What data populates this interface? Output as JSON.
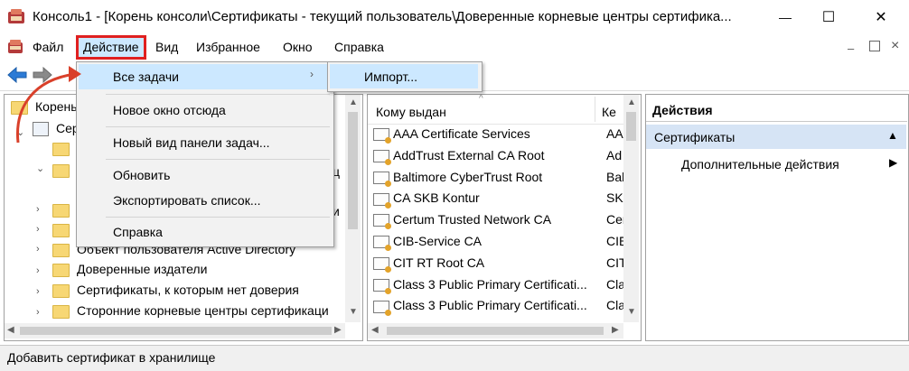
{
  "window": {
    "title": "Консоль1 - [Корень консоли\\Сертификаты - текущий пользователь\\Доверенные корневые центры сертифика...",
    "minimize": "—",
    "maximize": "☐",
    "close": "✕"
  },
  "menu": {
    "file": "Файл",
    "action": "Действие",
    "view": "Вид",
    "favorites": "Избранное",
    "window": "Окно",
    "help": "Справка",
    "inner_min": "–",
    "inner_restore": "ⓑ",
    "inner_close": "×"
  },
  "context_menu": {
    "all_tasks": "Все задачи",
    "new_window": "Новое окно отсюда",
    "new_taskpad": "Новый вид панели задач...",
    "refresh": "Обновить",
    "export_list": "Экспортировать список...",
    "help": "Справка",
    "submenu_import": "Импорт..."
  },
  "tree": {
    "root": "Корень",
    "certs": "Сер",
    "item_objects": "Объект пользователя Active Directory",
    "item_trusted_publishers": "Доверенные издатели",
    "item_untrusted": "Сертификаты, к которым нет доверия",
    "item_third_party": "Сторонние корневые центры сертификаци",
    "partial_1": "ц",
    "partial_2": "и"
  },
  "list": {
    "col_issued_to": "Кому выдан",
    "col_issued_by": "Ке",
    "rows": [
      {
        "to": "AAA Certificate Services",
        "by": "AA"
      },
      {
        "to": "AddTrust External CA Root",
        "by": "Ad"
      },
      {
        "to": "Baltimore CyberTrust Root",
        "by": "Bal"
      },
      {
        "to": "CA SKB Kontur",
        "by": "SKI"
      },
      {
        "to": "Certum Trusted Network CA",
        "by": "Cer"
      },
      {
        "to": "CIB-Service CA",
        "by": "CIE"
      },
      {
        "to": "CIT RT Root CA",
        "by": "CIT"
      },
      {
        "to": "Class 3 Public Primary Certificati...",
        "by": "Cla"
      },
      {
        "to": "Class 3 Public Primary Certificati...",
        "by": "Cla"
      }
    ]
  },
  "actions": {
    "header": "Действия",
    "section": "Сертификаты",
    "more": "Дополнительные действия"
  },
  "status": "Добавить сертификат в хранилище",
  "colors": {
    "highlight": "#cce8ff",
    "menu_red": "#e02020",
    "section_bg": "#d6e4f5",
    "arrow_red": "#d9402a"
  }
}
